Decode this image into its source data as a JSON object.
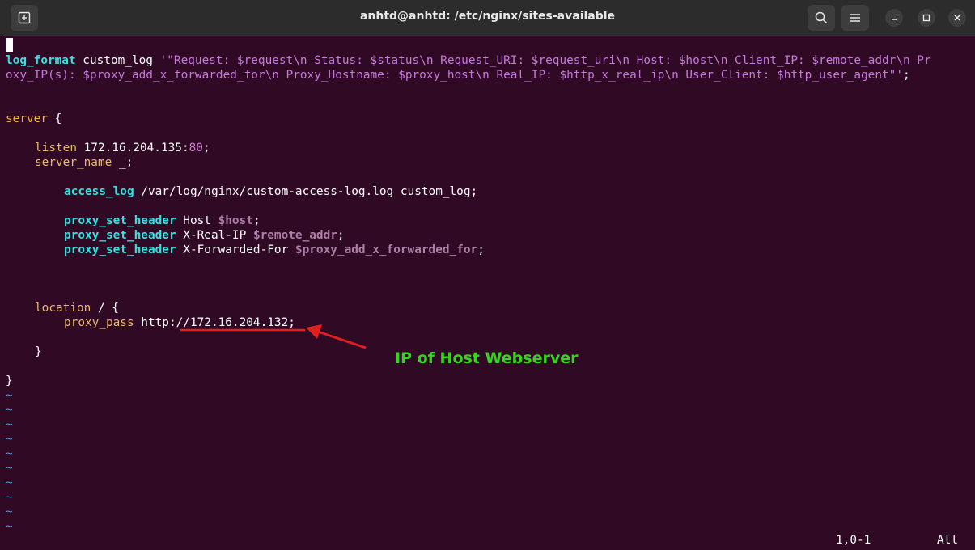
{
  "window": {
    "title": "anhtd@anhtd: /etc/nginx/sites-available",
    "new_tab_icon": "new-tab-icon",
    "search_icon": "search-icon",
    "menu_icon": "hamburger-menu-icon",
    "minimize_icon": "minimize-icon",
    "maximize_icon": "maximize-icon",
    "close_icon": "close-icon"
  },
  "editor": {
    "log_format_kw": "log_format",
    "log_format_name": " custom_log ",
    "log_format_str1": "'\"Request: $request\\n Status: $status\\n Request_URI: $request_uri\\n Host: $host\\n Client_IP: $remote_addr\\n Pr",
    "log_format_str2": "oxy_IP(s): $proxy_add_x_forwarded_for\\n Proxy_Hostname: $proxy_host\\n Real_IP: $http_x_real_ip\\n User_Client: $http_user_agent\"'",
    "log_format_end": ";",
    "server_kw": "server",
    "server_open": " {",
    "listen_kw": "listen",
    "listen_addr": " 172.16.204.135:",
    "listen_port": "80",
    "listen_end": ";",
    "server_name_kw": "server_name",
    "server_name_val": " _;",
    "access_log_kw": "access_log",
    "access_log_val": " /var/log/nginx/custom-access-log.log custom_log;",
    "psh1_kw": "proxy_set_header",
    "psh1_val": " Host ",
    "psh1_var": "$host",
    "psh1_end": ";",
    "psh2_kw": "proxy_set_header",
    "psh2_val": " X-Real-IP ",
    "psh2_var": "$remote_addr",
    "psh2_end": ";",
    "psh3_kw": "proxy_set_header",
    "psh3_val": " X-Forwarded-For ",
    "psh3_var": "$proxy_add_x_forwarded_for",
    "psh3_end": ";",
    "location_kw": "location",
    "location_val": " / {",
    "proxy_pass_kw": "proxy_pass",
    "proxy_pass_val": " http://172.16.204.132;",
    "close_inner": "}",
    "close_outer": "}",
    "tilde": "~"
  },
  "status": {
    "position": "1,0-1",
    "scroll": "All"
  },
  "annotation": {
    "label": "IP of Host Webserver",
    "color": "#33d61a",
    "arrow_color": "#e02020"
  }
}
